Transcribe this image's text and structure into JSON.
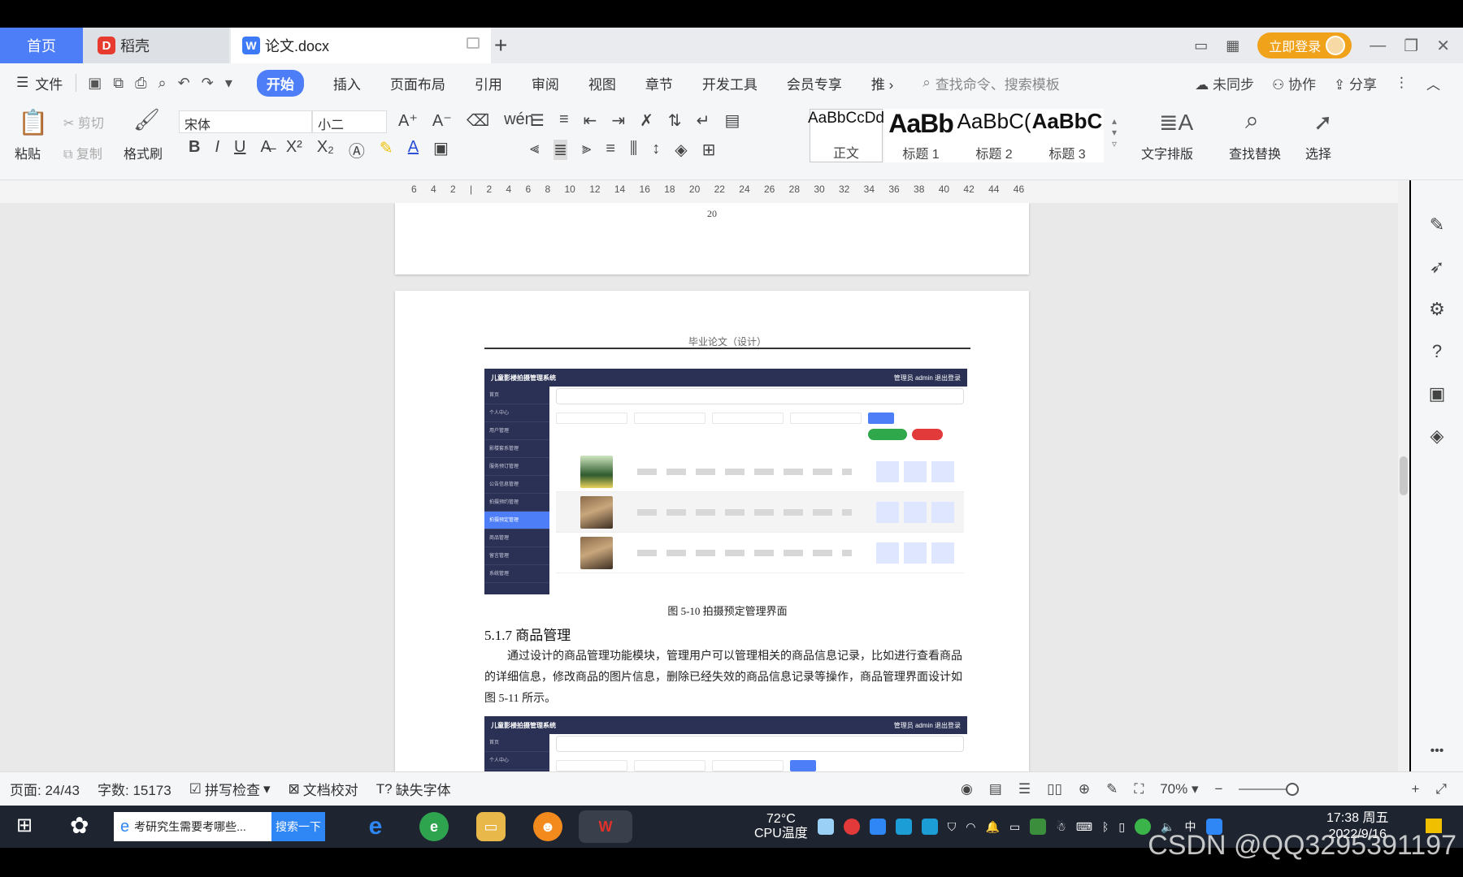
{
  "tabs": {
    "home": "首页",
    "daoke": "稻壳",
    "doc": "论文.docx",
    "login": "立即登录"
  },
  "menu": {
    "file": "文件",
    "items": [
      "开始",
      "插入",
      "页面布局",
      "引用",
      "审阅",
      "视图",
      "章节",
      "开发工具",
      "会员专享",
      "推"
    ],
    "search_placeholder": "查找命令、搜索模板",
    "sync": "未同步",
    "collab": "协作",
    "share": "分享"
  },
  "ribbon": {
    "paste": "粘贴",
    "cut": "剪切",
    "copy": "复制",
    "format_painter": "格式刷",
    "font_name": "宋体",
    "font_size": "小二",
    "styles": [
      {
        "sample": "AaBbCcDd",
        "label": "正文"
      },
      {
        "sample": "AaBb",
        "label": "标题 1"
      },
      {
        "sample": "AaBbC(",
        "label": "标题 2"
      },
      {
        "sample": "AaBbC",
        "label": "标题 3"
      }
    ],
    "text_layout": "文字排版",
    "find_replace": "查找替换",
    "select": "选择"
  },
  "ruler": {
    "numbers": "6 4 2 | 2 4 6 8 10 12 14 16 18 20 22 24 26 28 30 32 34 36 38 40 42 44 46"
  },
  "document": {
    "prev_page_number": "20",
    "header": "毕业论文（设计）",
    "screenshot1": {
      "title": "儿童影楼拍摄管理系统",
      "top_right": "管理员 admin   退出登录",
      "menu": [
        "首页",
        "个人中心",
        "用户管理",
        "影楼套系管理",
        "服务预订管理",
        "公告信息管理",
        "拍摄预约管理",
        "拍摄预定管理",
        "商品管理",
        "留言管理",
        "系统管理"
      ]
    },
    "figure_caption": "图 5-10 拍摄预定管理界面",
    "section_title": "5.1.7 商品管理",
    "paragraph": "通过设计的商品管理功能模块，管理用户可以管理相关的商品信息记录，比如进行查看商品的详细信息，修改商品的图片信息，删除已经失效的商品信息记录等操作，商品管理界面设计如图 5-11 所示。",
    "screenshot2": {
      "title": "儿童影楼拍摄管理系统",
      "top_right": "管理员 admin   退出登录",
      "menu": [
        "首页",
        "个人中心"
      ]
    }
  },
  "status": {
    "page": "页面: 24/43",
    "words": "字数: 15173",
    "spell": "拼写检查",
    "proof": "文档校对",
    "missing_font": "缺失字体",
    "zoom": "70%"
  },
  "taskbar": {
    "search_text": "考研究生需要考哪些...",
    "search_button": "搜索一下",
    "temp": "72°C",
    "temp_label": "CPU温度",
    "ime": "中",
    "time": "17:38 周五",
    "date": "2022/9/16"
  },
  "watermark": "CSDN @QQ3295391197",
  "colors": {
    "accent": "#4d7ef7",
    "login": "#f0a21b",
    "taskbar": "#1e2430",
    "sidebar_dark": "#2b3154"
  }
}
